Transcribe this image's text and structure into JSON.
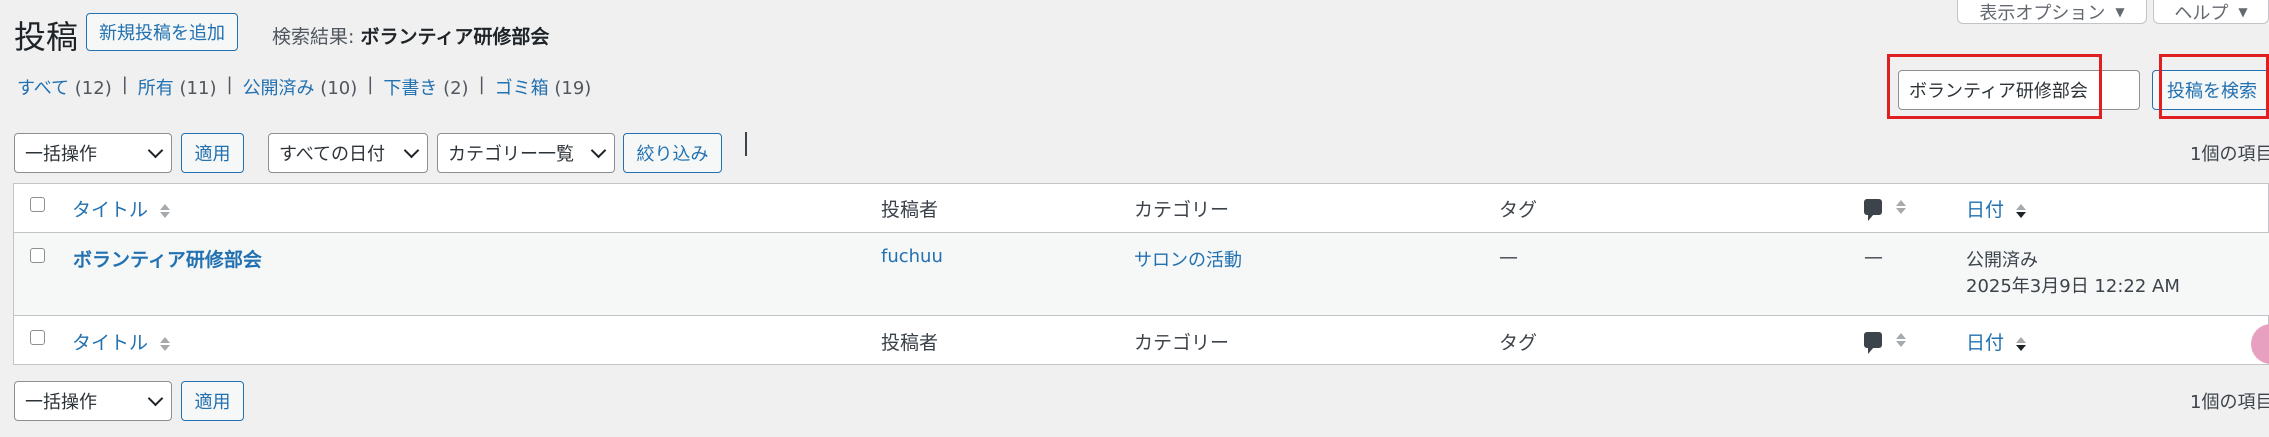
{
  "header": {
    "title": "投稿",
    "add_new": "新規投稿を追加",
    "search_result_label": "検索結果:",
    "search_result_query": "ボランティア研修部会",
    "screen_options": "表示オプション",
    "help": "ヘルプ"
  },
  "views": [
    {
      "label": "すべて",
      "count": "(12)"
    },
    {
      "label": "所有",
      "count": "(11)"
    },
    {
      "label": "公開済み",
      "count": "(10)"
    },
    {
      "label": "下書き",
      "count": "(2)"
    },
    {
      "label": "ゴミ箱",
      "count": "(19)"
    }
  ],
  "search": {
    "value": "ボランティア研修部会",
    "button": "投稿を検索"
  },
  "filters": {
    "bulk_action": "一括操作",
    "apply": "適用",
    "dates": "すべての日付",
    "categories": "カテゴリー一覧",
    "filter": "絞り込み",
    "item_count": "1個の項目"
  },
  "table": {
    "columns": {
      "title": "タイトル",
      "author": "投稿者",
      "categories": "カテゴリー",
      "tags": "タグ",
      "date": "日付"
    },
    "rows": [
      {
        "title": "ボランティア研修部会",
        "author": "fuchuu",
        "category": "サロンの活動",
        "tags": "—",
        "comments": "—",
        "status": "公開済み",
        "date": "2025年3月9日 12:22 AM"
      }
    ]
  },
  "colors": {
    "link": "#2271b1",
    "background": "#f0f0f1",
    "highlight_box": "#e02020"
  }
}
